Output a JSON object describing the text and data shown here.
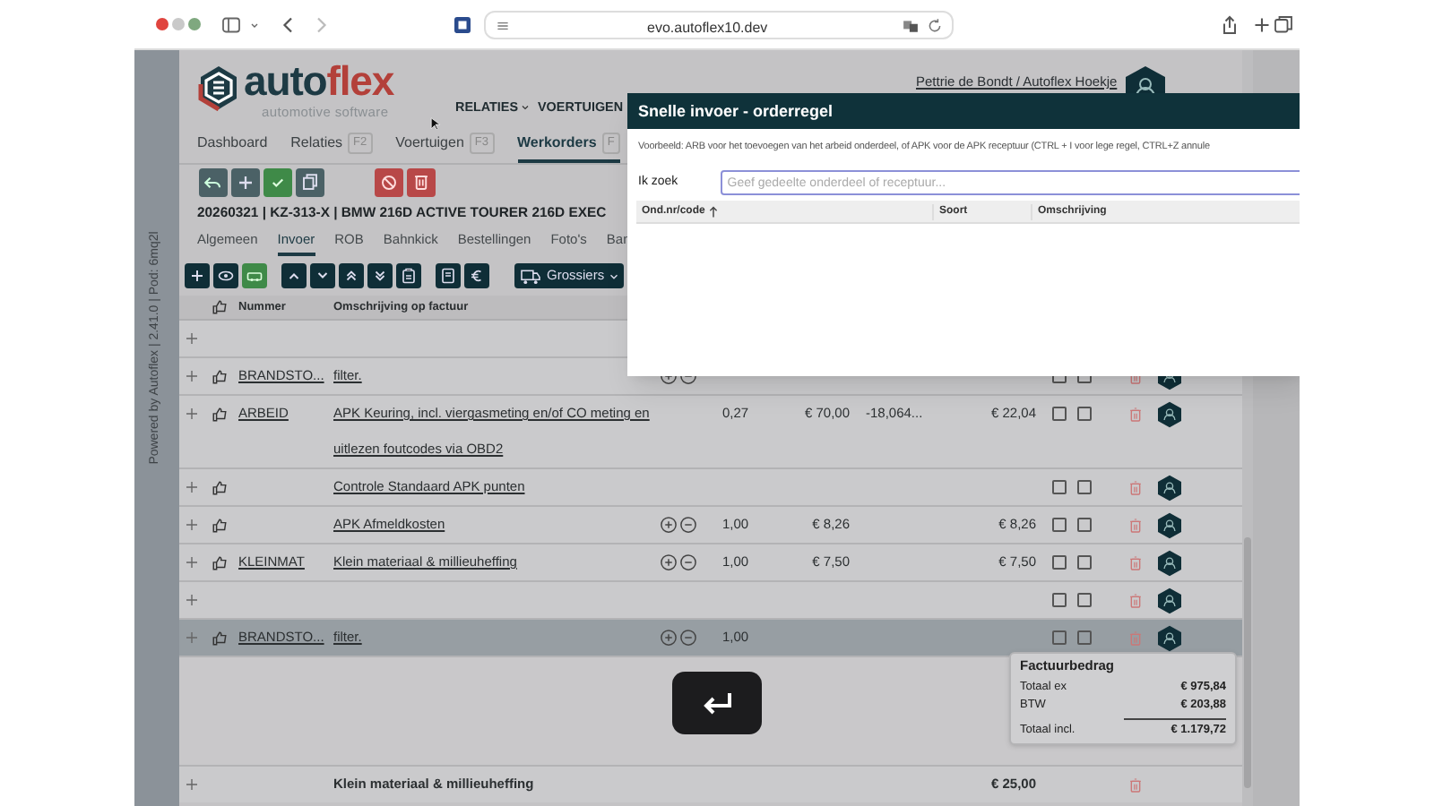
{
  "browser": {
    "url": "evo.autoflex10.dev"
  },
  "side_strip": {
    "text": "Powered by Autoflex | 2.41.0 | Pod: 6mq2l"
  },
  "header": {
    "wordmark": [
      {
        "text": "auto",
        "color": "#1d3a44"
      },
      {
        "text": "flex",
        "color": "#b3403a"
      }
    ],
    "tagline": "automotive software",
    "nav": [
      {
        "label": "RELATIES",
        "dropdown": true
      },
      {
        "label": "VOERTUIGEN",
        "dropdown": false
      }
    ],
    "user": "Pettrie de Bondt / Autoflex Hoekje"
  },
  "tabs": [
    {
      "label": "Dashboard",
      "selected": false
    },
    {
      "label": "Relaties",
      "key": "F2",
      "selected": false
    },
    {
      "label": "Voertuigen",
      "key": "F3",
      "selected": false
    },
    {
      "label": "Werkorders",
      "key": "F",
      "selected": true
    }
  ],
  "actions": [
    {
      "kind": "back"
    },
    {
      "kind": "add"
    },
    {
      "kind": "confirm"
    },
    {
      "kind": "copy"
    },
    {
      "kind": "cancel"
    },
    {
      "kind": "delete"
    }
  ],
  "title": "20260321 | KZ-313-X | BMW 216D ACTIVE TOURER 216D EXEC",
  "subtabs": [
    {
      "label": "Algemeen",
      "selected": false
    },
    {
      "label": "Invoer",
      "selected": true
    },
    {
      "label": "ROB",
      "selected": false
    },
    {
      "label": "Bahnkick",
      "selected": false
    },
    {
      "label": "Bestellingen",
      "selected": false
    },
    {
      "label": "Foto's",
      "selected": false
    },
    {
      "label": "Ban",
      "selected": false
    }
  ],
  "line_tools": [
    {
      "kind": "add"
    },
    {
      "kind": "view"
    },
    {
      "kind": "car"
    },
    {
      "kind": "up"
    },
    {
      "kind": "down"
    },
    {
      "kind": "top"
    },
    {
      "kind": "bottom"
    },
    {
      "kind": "clipboard"
    },
    {
      "kind": "book"
    },
    {
      "kind": "euro"
    }
  ],
  "supplier_button": {
    "label": "Grossiers"
  },
  "table": {
    "columns": [
      "Nummer",
      "Omschrijving op factuur"
    ],
    "rows": [
      {
        "kind": "empty",
        "selected": false
      },
      {
        "kind": "line",
        "number": "BRANDSTO...",
        "description": "filter.",
        "adjust": true,
        "flags": [
          false,
          false
        ],
        "selected": false
      },
      {
        "kind": "line",
        "number": "ARBEID",
        "description": "APK Keuring, incl. viergasmeting en/of CO meting en uitlezen foutcodes via OBD2",
        "adjust": false,
        "qty": "0,27",
        "price": "€ 70,00",
        "discount": "-18,064...",
        "total": "€ 22,04",
        "flags": [
          false,
          false
        ],
        "selected": false
      },
      {
        "kind": "line",
        "description": "Controle Standaard APK punten",
        "adjust": false,
        "flags": [
          false,
          false
        ],
        "selected": false
      },
      {
        "kind": "line",
        "description": "APK Afmeldkosten",
        "adjust": true,
        "qty": "1,00",
        "price": "€ 8,26",
        "total": "€ 8,26",
        "flags": [
          false,
          false
        ],
        "selected": false
      },
      {
        "kind": "line",
        "number": "KLEINMAT",
        "description": "Klein materiaal & millieuheffing",
        "adjust": true,
        "qty": "1,00",
        "price": "€ 7,50",
        "total": "€ 7,50",
        "flags": [
          false,
          false
        ],
        "selected": false
      },
      {
        "kind": "empty",
        "flags": [
          false,
          false
        ],
        "selected": false
      },
      {
        "kind": "line",
        "number": "BRANDSTO...",
        "description": "filter.",
        "adjust": true,
        "qty": "1,00",
        "flags": [
          false,
          false
        ],
        "selected": true
      }
    ],
    "summary_row": {
      "description": "Klein materiaal & millieuheffing",
      "total": "€ 25,00"
    }
  },
  "invoice": {
    "title": "Factuurbedrag",
    "lines": [
      {
        "label": "Totaal ex",
        "value": "€ 975,84",
        "total": false
      },
      {
        "label": "BTW",
        "value": "€ 203,88",
        "total": false
      },
      {
        "label": "Totaal incl.",
        "value": "€ 1.179,72",
        "total": true
      }
    ]
  },
  "dialog": {
    "title": "Snelle invoer - orderregel",
    "hint": "Voorbeeld: ARB voor het toevoegen van het arbeid onderdeel, of APK voor de APK receptuur (CTRL + I voor lege regel, CTRL+Z annule",
    "search_label": "Ik zoek",
    "placeholder": "Geef gedeelte onderdeel of receptuur...",
    "columns": [
      {
        "label": "Ond.nr/code",
        "sorted": true
      },
      {
        "label": "Soort",
        "sorted": false
      },
      {
        "label": "Omschrijving",
        "sorted": false
      }
    ]
  }
}
